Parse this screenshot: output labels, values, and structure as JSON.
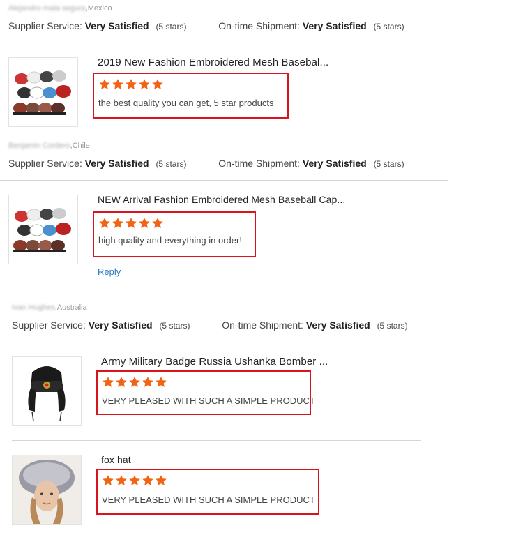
{
  "labels": {
    "supplier_service": "Supplier Service:",
    "ontime_shipment": "On-time Shipment:",
    "reply": "Reply"
  },
  "colors": {
    "star": "#f06414",
    "highlight_box": "#d9141c",
    "reply_link": "#2a7ac0"
  },
  "reviews": [
    {
      "buyer_name": "Alejandro mata segura",
      "country": ",Mexico",
      "supplier_service": "Very Satisfied",
      "supplier_stars": "(5 stars)",
      "shipment": "Very Satisfied",
      "shipment_stars": "(5 stars)",
      "products": [
        {
          "title": "2019 New Fashion Embroidered Mesh Basebal...",
          "rating": 5,
          "text": "the best quality you can get, 5 star products",
          "image_icon": "baseball-caps-image"
        }
      ]
    },
    {
      "buyer_name": "Benjamin Cordero",
      "country": ",Chile",
      "supplier_service": "Very Satisfied",
      "supplier_stars": "(5 stars)",
      "shipment": "Very Satisfied",
      "shipment_stars": "(5 stars)",
      "products": [
        {
          "title": "NEW Arrival Fashion Embroidered Mesh Baseball Cap...",
          "rating": 5,
          "text": "high quality and everything in order!",
          "image_icon": "baseball-caps-image"
        }
      ]
    },
    {
      "buyer_name": "Ivan Hughes",
      "country": ",Australia",
      "supplier_service": "Very Satisfied",
      "supplier_stars": "(5 stars)",
      "shipment": "Very Satisfied",
      "shipment_stars": "(5 stars)",
      "products": [
        {
          "title": "Army Military Badge Russia Ushanka Bomber ...",
          "rating": 5,
          "text": "VERY PLEASED WITH SUCH A SIMPLE PRODUCT",
          "image_icon": "ushanka-hat-image"
        },
        {
          "title": "fox hat",
          "rating": 5,
          "text": "VERY PLEASED WITH SUCH A SIMPLE PRODUCT",
          "image_icon": "fox-fur-hat-image"
        }
      ]
    }
  ]
}
